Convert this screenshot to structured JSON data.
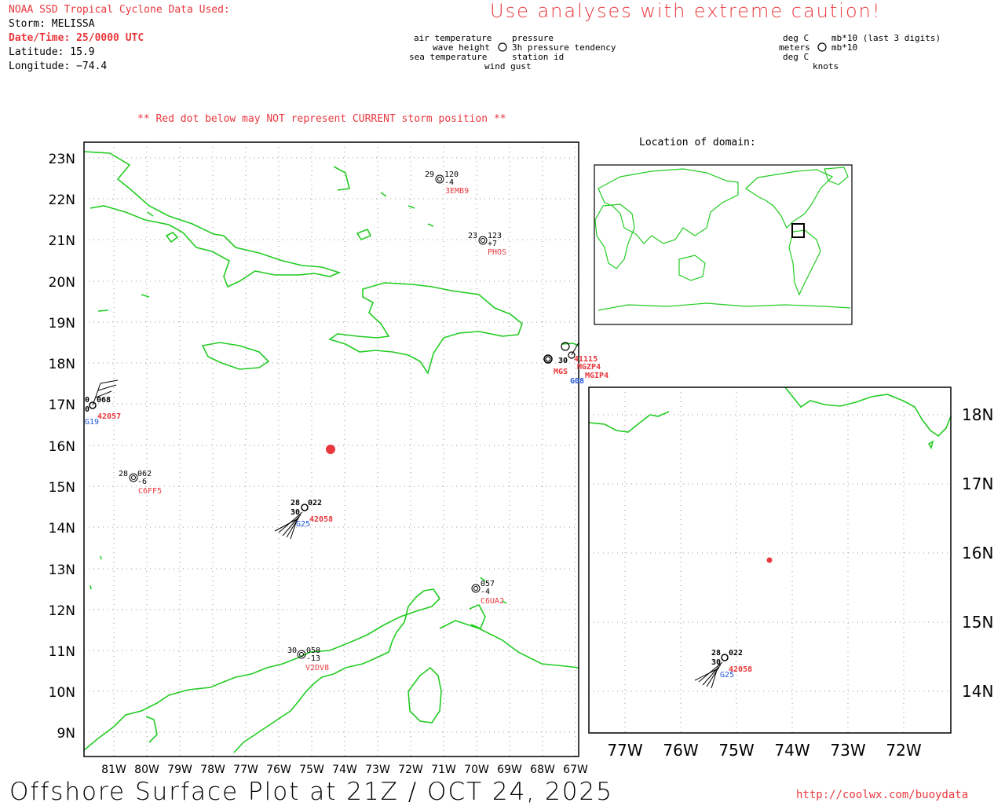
{
  "header": {
    "source_title": "NOAA SSD Tropical Cyclone Data Used:",
    "storm": "Storm: MELISSA",
    "datetime": "Date/Time: 25/0000 UTC",
    "latitude": "Latitude: 15.9",
    "longitude": "Longitude: −74.4",
    "caution": "Use analyses with extreme caution!",
    "red_dot_note": "** Red dot below may NOT represent CURRENT storm position **"
  },
  "legend": {
    "air_temperature": "air temperature",
    "wave_height": "wave height",
    "sea_temperature": "sea temperature",
    "pressure": "pressure",
    "pressure_tendency": "3h pressure tendency",
    "station_id": "station id",
    "wind_gust": "wind gust",
    "unit_air": "deg C",
    "unit_wave": "meters",
    "unit_sea": "deg C",
    "unit_pressure": "mb*10 (last 3 digits)",
    "unit_tendency": "mb*10",
    "unit_wind": "knots"
  },
  "location_title": "Location of domain:",
  "main_map": {
    "lat_labels": [
      "23N",
      "22N",
      "21N",
      "20N",
      "19N",
      "18N",
      "17N",
      "16N",
      "15N",
      "14N",
      "13N",
      "12N",
      "11N",
      "10N",
      "9N"
    ],
    "lon_labels": [
      "81W",
      "80W",
      "79W",
      "78W",
      "77W",
      "76W",
      "75W",
      "74W",
      "73W",
      "72W",
      "71W",
      "70W",
      "69W",
      "68W",
      "67W"
    ]
  },
  "inset_map": {
    "lat_labels": [
      "18N",
      "17N",
      "16N",
      "15N",
      "14N"
    ],
    "lon_labels": [
      "77W",
      "76W",
      "75W",
      "74W",
      "73W",
      "72W"
    ]
  },
  "stations": [
    {
      "id": "3EMB9",
      "air": "29",
      "pressure": "120",
      "tendency": "-4"
    },
    {
      "id": "PHOS",
      "air": "23",
      "pressure": "123",
      "tendency": "+7"
    },
    {
      "id": "C6FF5",
      "air": "28",
      "pressure": "062",
      "tendency": "-6"
    },
    {
      "id": "42057",
      "pressure": "068",
      "air": "0",
      "sea": "0",
      "gust": "G19"
    },
    {
      "id": "42058",
      "air": "28",
      "pressure": "022",
      "sea": "30",
      "gust": "G25"
    },
    {
      "id": "C6UA2",
      "pressure": "057",
      "tendency": "-4"
    },
    {
      "id": "V2DV8",
      "air": "30",
      "pressure": "058",
      "tendency": "-13"
    },
    {
      "id": "41115",
      "air": "30"
    },
    {
      "id": "MGZP4"
    },
    {
      "id": "MGIP4",
      "gust": "G08"
    },
    {
      "id": "MGS"
    }
  ],
  "colors": {
    "coast": "#22cc22",
    "accent": "#e8383d",
    "station_id": "#e8383d",
    "gust": "#2255dd"
  },
  "footer": {
    "title": "Offshore Surface Plot at 21Z / OCT 24, 2025",
    "url": "http://coolwx.com/buoydata"
  }
}
